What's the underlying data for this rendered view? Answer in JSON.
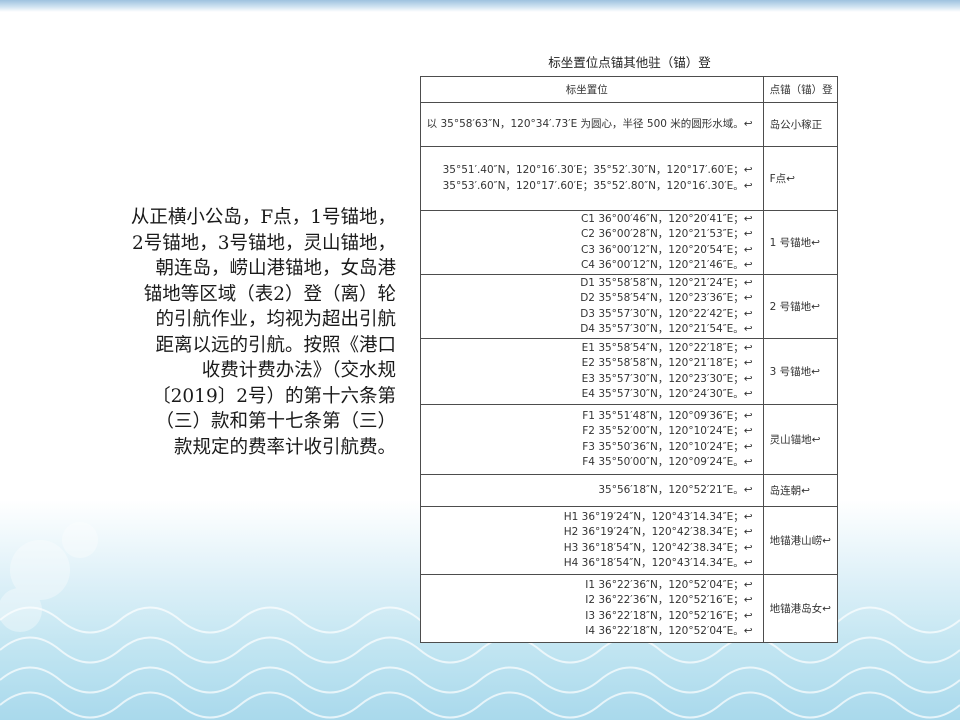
{
  "slide": {
    "title": "标坐置位点锚其他驻（锚）登",
    "table": {
      "header": {
        "point": "点锚（锚）登",
        "coord": "标坐置位"
      },
      "rows": [
        {
          "point": "岛公小稼正",
          "lines": [
            "以 35°58′63″N，120°34′.73′E 为圆心，半径 500 米的圆形水域。↩"
          ]
        },
        {
          "point": "F点↩",
          "lines": [
            "35°51′.40″N，120°16′.30′E；35°52′.30″N，120°17′.60′E；↩",
            "35°53′.60″N，120°17′.60′E；35°52′.80″N，120°16′.30′E。↩"
          ]
        },
        {
          "point": "1 号锚地↩",
          "lines": [
            "C1 36°00′46″N，120°20′41″E；↩",
            "C2 36°00′28″N，120°21′53″E；↩",
            "C3 36°00′12″N，120°20′54″E；↩",
            "C4 36°00′12″N，120°21′46″E。↩"
          ]
        },
        {
          "point": "2 号锚地↩",
          "lines": [
            "D1 35°58′58″N，120°21′24″E；↩",
            "D2 35°58′54″N，120°23′36″E；↩",
            "D3 35°57′30″N，120°22′42″E；↩",
            "D4 35°57′30″N，120°21′54″E。↩"
          ]
        },
        {
          "point": "3 号锚地↩",
          "lines": [
            "E1 35°58′54″N，120°22′18″E；↩",
            "E2 35°58′58″N，120°21′18″E；↩",
            "E3 35°57′30″N，120°23′30″E；↩",
            "E4 35°57′30″N，120°24′30″E。↩"
          ]
        },
        {
          "point": "灵山锚地↩",
          "lines": [
            "F1 35°51′48″N，120°09′36″E；↩",
            "F2 35°52′00″N，120°10′24″E；↩",
            "F3 35°50′36″N，120°10′24″E；↩",
            "F4 35°50′00″N，120°09′24″E。↩"
          ]
        },
        {
          "point": "岛连朝↩",
          "lines": [
            "35°56′18″N，120°52′21″E。↩"
          ]
        },
        {
          "point": "地锚港山崂↩",
          "lines": [
            "H1 36°19′24″N，120°43′14.34″E；↩",
            "H2 36°19′24″N，120°42′38.34″E；↩",
            "H3 36°18′54″N，120°42′38.34″E；↩",
            "H4 36°18′54″N，120°43′14.34″E。↩"
          ]
        },
        {
          "point": "地锚港岛女↩",
          "lines": [
            "I1 36°22′36″N，120°52′04″E；↩",
            "I2 36°22′36″N，120°52′16″E；↩",
            "I3 36°22′18″N，120°52′16″E；↩",
            "I4 36°22′18″N，120°52′04″E。↩"
          ]
        }
      ]
    },
    "side_text": [
      "从正横小公岛，F点，1号锚地，",
      "2号锚地，3号锚地，灵山锚地，",
      "朝连岛，崂山港锚地，女岛港",
      "锚地等区域（表2）登（离）轮",
      "的引航作业，均视为超出引航",
      "距离以远的引航。按照《港口",
      "收费计费办法》（交水规",
      "〔2019〕2号）的第十六条第",
      "（三）款和第十七条第（三）",
      "款规定的费率计收引航费。"
    ]
  }
}
